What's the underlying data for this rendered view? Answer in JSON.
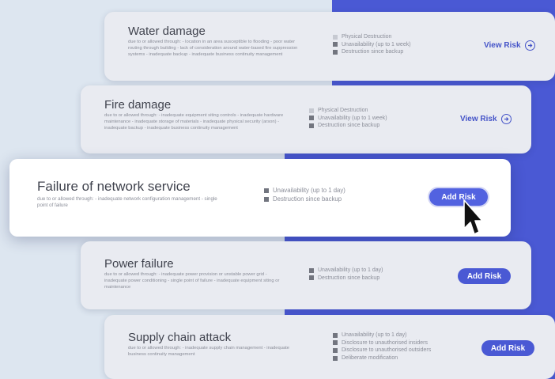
{
  "risks": [
    {
      "title": "Water damage",
      "description": "due to or allowed through: - location in an area susceptible to flooding - poor water routing through building - lack of consideration around water-based fire suppression systems - inadequate backup - inadequate business continuity management",
      "impacts": [
        "Physical Destruction",
        "Unavailability (up to 1 week)",
        "Destruction since backup"
      ],
      "action": "View Risk"
    },
    {
      "title": "Fire damage",
      "description": "due to or allowed through: - inadequate equipment siting controls - inadequate hardware maintenance - inadequate storage of materials - inadequate physical security (arson) - inadequate backup - inadequate business continuity management",
      "impacts": [
        "Physical Destruction",
        "Unavailability (up to 1 week)",
        "Destruction since backup"
      ],
      "action": "View Risk"
    },
    {
      "title": "Failure of network service",
      "description": "due to or allowed through: - inadequate network configuration management - single point of failure",
      "impacts": [
        "Unavailability (up to 1 day)",
        "Destruction since backup"
      ],
      "action": "Add Risk"
    },
    {
      "title": "Power failure",
      "description": "due to or allowed through: - inadequate power provision or unstable power grid - inadequate power conditioning - single point of failure - inadequate equipment siting or maintenance",
      "impacts": [
        "Unavailability (up to 1 day)",
        "Destruction since backup"
      ],
      "action": "Add Risk"
    },
    {
      "title": "Supply chain attack",
      "description": "due to or allowed through: - inadequate supply chain management - inadequate business continuity management",
      "impacts": [
        "Unavailability (up to 1 day)",
        "Disclosure to unauthorised insiders",
        "Disclosure to unauthorised outsiders",
        "Deliberate modification"
      ],
      "action": "Add Risk"
    }
  ],
  "colors": {
    "accent": "#4a59d4",
    "card": "#e9ebf1",
    "background": "#dde6f0"
  }
}
